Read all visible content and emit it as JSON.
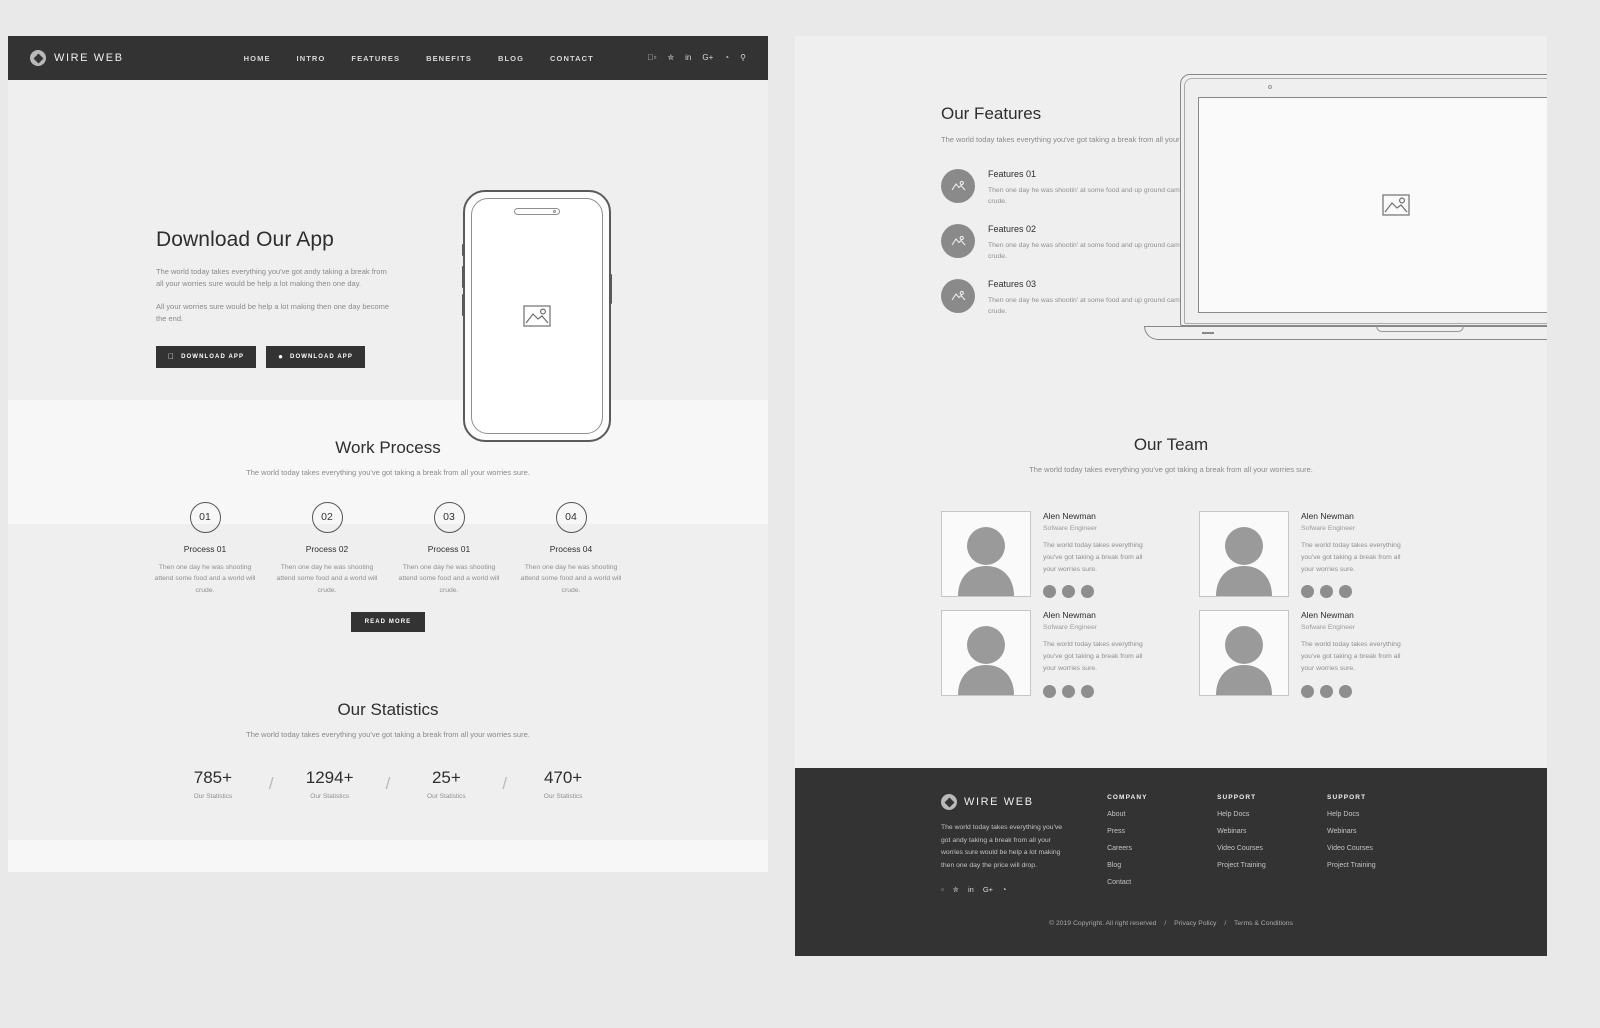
{
  "nav": {
    "brand": "WIRE WEB",
    "links": [
      "HOME",
      "INTRO",
      "FEATURES",
      "BENEFITS",
      "BLOG",
      "CONTACT"
    ],
    "social": [
      "f",
      "t",
      "in",
      "G+",
      "rss"
    ],
    "search": "search-icon"
  },
  "hero": {
    "title": "Download Our App",
    "paragraph1": "The world today takes everything you've got andy taking a break from all your worries sure would be help a lot making then one day.",
    "paragraph2": "All your worries sure would be help a lot making then one day become the end.",
    "button_apple": "DOWNLOAD APP",
    "button_android": "DOWNLOAD APP"
  },
  "work_process": {
    "title": "Work Process",
    "subtitle": "The world today takes everything you've got taking a break from all your worries sure.",
    "steps": [
      {
        "num": "01",
        "name": "Process 01",
        "desc": "Then one day he was shooting attend some food and a world will crude."
      },
      {
        "num": "02",
        "name": "Process 02",
        "desc": "Then one day he was shooting attend some food and a world will crude."
      },
      {
        "num": "03",
        "name": "Process 01",
        "desc": "Then one day he was shooting attend some food and a world will crude."
      },
      {
        "num": "04",
        "name": "Process 04",
        "desc": "Then one day he was shooting attend some food and a world will crude."
      }
    ],
    "read_more": "READ MORE"
  },
  "statistics": {
    "title": "Our Statistics",
    "subtitle": "The world today takes everything you've got taking a break from all your worries sure.",
    "items": [
      {
        "value": "785+",
        "label": "Our Statistics"
      },
      {
        "value": "1294+",
        "label": "Our Statistics"
      },
      {
        "value": "25+",
        "label": "Our Statistics"
      },
      {
        "value": "470+",
        "label": "Our Statistics"
      }
    ],
    "separator": "/"
  },
  "features": {
    "title": "Our Features",
    "subtitle": "The world today takes everything you've got taking a break from all your worries sure.",
    "items": [
      {
        "title": "Features 01",
        "desc": "Then one day he was shootin' at some food and up ground came a bubbling crude.",
        "icon": "image-icon"
      },
      {
        "title": "Features 02",
        "desc": "Then one day he was shootin' at some food and up ground came a bubbling crude.",
        "icon": "image-icon"
      },
      {
        "title": "Features 03",
        "desc": "Then one day he was shootin' at some food and up ground came a bubbling crude.",
        "icon": "image-icon"
      }
    ],
    "mockup": "laptop-mockup"
  },
  "team": {
    "title": "Our Team",
    "subtitle": "The world today takes everything you've got taking a break from all your worries sure.",
    "members": [
      {
        "name": "Alen Newman",
        "role": "Sofware Engineer",
        "bio": "The world today takes everything you've got taking a break from all your worries sure."
      },
      {
        "name": "Alen Newman",
        "role": "Sofware Engineer",
        "bio": "The world today takes everything you've got taking a break from all your worries sure."
      },
      {
        "name": "Alen Newman",
        "role": "Sofware Engineer",
        "bio": "The world today takes everything you've got taking a break from all your worries sure."
      },
      {
        "name": "Alen Newman",
        "role": "Sofware Engineer",
        "bio": "The world today takes everything you've got taking a break from all your worries sure."
      }
    ]
  },
  "footer": {
    "brand": "WIRE WEB",
    "about": "The world today takes everything you've got andy taking a break from all your worries sure would be help a lot making then one day the price will drop.",
    "social": [
      "f",
      "t",
      "in",
      "G+",
      "rss"
    ],
    "columns": [
      {
        "title": "COMPANY",
        "links": [
          "About",
          "Press",
          "Careers",
          "Blog",
          "Contact"
        ]
      },
      {
        "title": "SUPPORT",
        "links": [
          "Help Docs",
          "Webinars",
          "Video Courses",
          "Project Training"
        ]
      },
      {
        "title": "SUPPORT",
        "links": [
          "Help Docs",
          "Webinars",
          "Video Courses",
          "Project Training"
        ]
      }
    ],
    "copyright": "© 2019 Copyright. All right reserved",
    "privacy": "Privacy Policy",
    "terms": "Terms & Conditions",
    "divider": "/"
  },
  "colors": {
    "dark": "#333333",
    "page_bg": "#e9e9e9",
    "panel_bg": "#efefef",
    "muted_text": "#8f8f8f"
  }
}
